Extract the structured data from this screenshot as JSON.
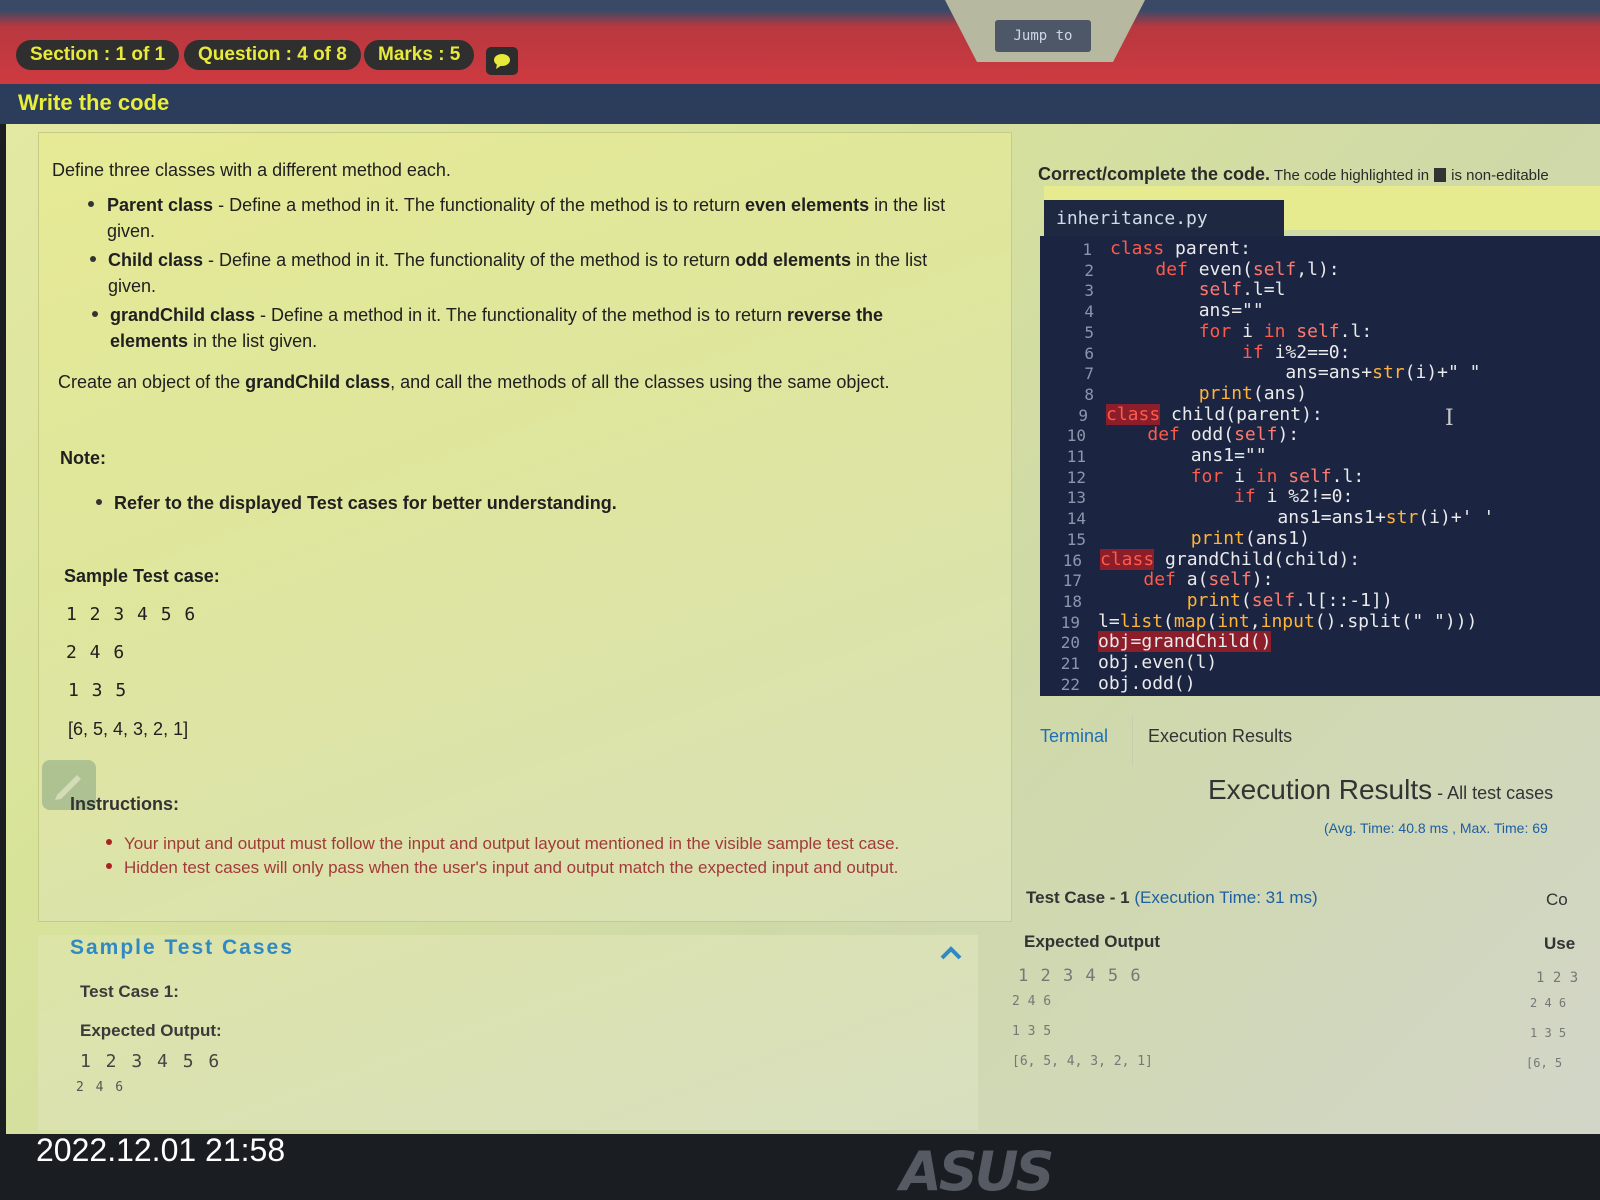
{
  "header": {
    "section": "Section : 1 of 1",
    "question": "Question : 4 of 8",
    "marks": "Marks : 5",
    "chat_icon": "chat-bubble-icon",
    "jump_to": "Jump to",
    "page_title": "Write the code"
  },
  "question": {
    "intro": "Define three classes with a different method each.",
    "bullets": [
      {
        "name": "Parent class",
        "sep": " - ",
        "text1": "Define a method in it. The functionality of the method is to return ",
        "bold": "even elements",
        "text2": " in the list",
        "cont": "given."
      },
      {
        "name": "Child class",
        "sep": " - ",
        "text1": "Define a method in it. The functionality of the method is to return ",
        "bold": "odd elements",
        "text2": " in the list",
        "cont": "given."
      },
      {
        "name": "grandChild class",
        "sep": " - ",
        "text1": "Define a method in it. The functionality of the method is to return ",
        "bold": "reverse the",
        "text2": "",
        "cont_bold": "elements",
        "cont": " in the list given."
      }
    ],
    "create_pre": "Create an object of the ",
    "create_bold": "grandChild class",
    "create_post": ", and call the methods of all the classes using the same object.",
    "note_label": "Note:",
    "note_item": "Refer to the displayed Test cases for better understanding.",
    "sample_label": "Sample Test case:",
    "sample_lines": [
      "1 2 3 4 5 6",
      "2 4 6",
      "1 3 5",
      "[6, 5, 4, 3, 2, 1]"
    ],
    "instructions_label": "Instructions:",
    "instructions": [
      "Your input and output must follow the input and output layout mentioned in the visible sample test case.",
      "Hidden test cases will only pass when the user's input and output match the expected input and output."
    ]
  },
  "sample_tests": {
    "title": "Sample Test Cases",
    "case_label": "Test Case 1:",
    "expected_label": "Expected Output:",
    "lines": [
      "1 2 3 4 5 6",
      "2 4 6"
    ]
  },
  "editor": {
    "instruction_bold": "Correct/complete the code.",
    "instruction_rest": " The code highlighted in",
    "instruction_tail": "is non-editable",
    "filename": "inheritance.py",
    "lines": [
      {
        "n": "1",
        "code": "class parent:"
      },
      {
        "n": "2",
        "code": "    def even(self,l):"
      },
      {
        "n": "3",
        "code": "        self.l=l"
      },
      {
        "n": "4",
        "code": "        ans=\"\""
      },
      {
        "n": "5",
        "code": "        for i in self.l:"
      },
      {
        "n": "6",
        "code": "            if i%2==0:"
      },
      {
        "n": "7",
        "code": "                ans=ans+str(i)+\" \""
      },
      {
        "n": "8",
        "code": "        print(ans)"
      },
      {
        "n": "9",
        "code": "class child(parent):"
      },
      {
        "n": "10",
        "code": "    def odd(self):"
      },
      {
        "n": "11",
        "code": "        ans1=\"\""
      },
      {
        "n": "12",
        "code": "        for i in self.l:"
      },
      {
        "n": "13",
        "code": "            if i %2!=0:"
      },
      {
        "n": "14",
        "code": "                ans1=ans1+str(i)+' '"
      },
      {
        "n": "15",
        "code": "        print(ans1)"
      },
      {
        "n": "16",
        "code": "class grandChild(child):"
      },
      {
        "n": "17",
        "code": "    def a(self):"
      },
      {
        "n": "18",
        "code": "        print(self.l[::-1])"
      },
      {
        "n": "19",
        "code": "l=list(map(int,input().split(\" \")))"
      },
      {
        "n": "20",
        "code": "obj=grandChild()"
      },
      {
        "n": "21",
        "code": "obj.even(l)"
      },
      {
        "n": "22",
        "code": "obj.odd()"
      }
    ]
  },
  "tabs": [
    "Terminal",
    "Execution Results"
  ],
  "results": {
    "title": "Execution Results",
    "title_suffix": " - All test cases",
    "timing": "(Avg. Time: 40.8 ms , Max. Time: 69",
    "case_label": "Test Case - 1",
    "case_time": "(Execution Time: 31 ms)",
    "col_right_cut": "Co",
    "expected_label": "Expected Output",
    "user_label_cut": "Use",
    "expected_lines": [
      "1 2 3 4 5 6",
      "2  4  6",
      "1  3  5",
      "[6,  5,  4,  3,  2,  1]"
    ],
    "user_lines_cut": [
      "1 2 3",
      "2 4 6",
      "1 3 5",
      "[6, 5"
    ]
  },
  "footer": {
    "timestamp": "2022.12.01 21:58",
    "brand": "ASUS"
  }
}
